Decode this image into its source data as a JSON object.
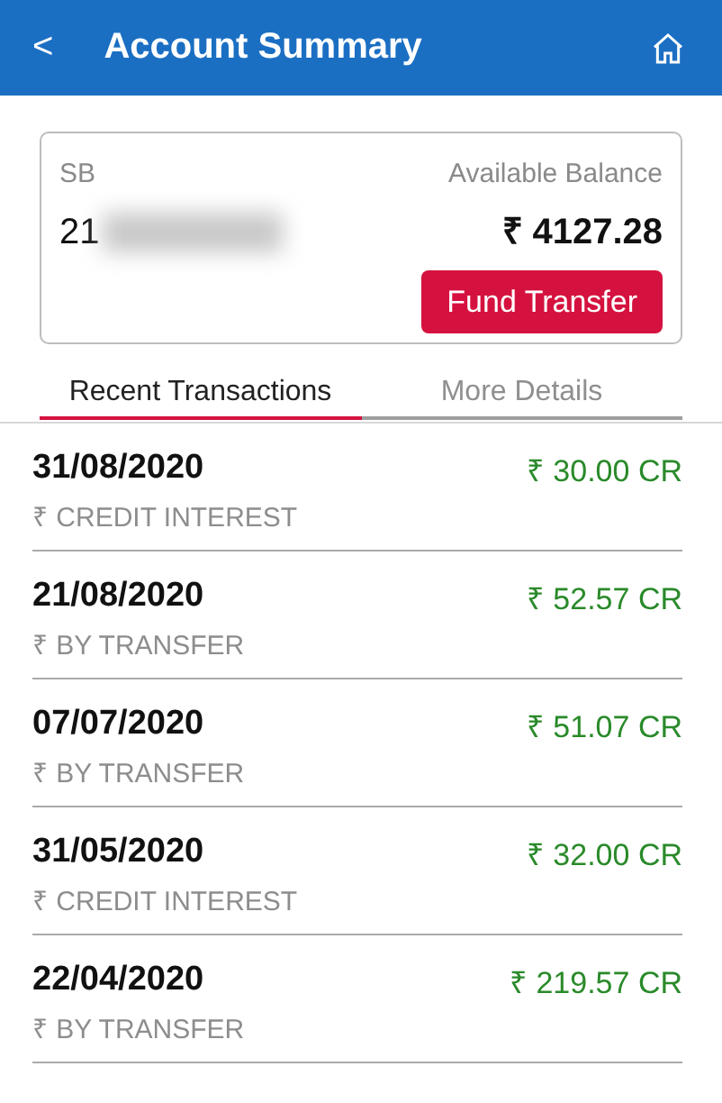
{
  "header": {
    "back": "<",
    "title": "Account Summary"
  },
  "account": {
    "type": "SB",
    "number": "21",
    "balance_label": "Available Balance",
    "balance": "₹ 4127.28",
    "fund_transfer": "Fund Transfer"
  },
  "tabs": [
    {
      "label": "Recent Transactions",
      "selected": true
    },
    {
      "label": "More Details",
      "selected": false
    }
  ],
  "transactions": [
    {
      "date": "31/08/2020",
      "description": "₹ CREDIT INTEREST",
      "amount": "₹ 30.00 CR"
    },
    {
      "date": "21/08/2020",
      "description": "₹ BY TRANSFER",
      "amount": "₹ 52.57 CR"
    },
    {
      "date": "07/07/2020",
      "description": "₹ BY TRANSFER",
      "amount": "₹ 51.07 CR"
    },
    {
      "date": "31/05/2020",
      "description": "₹ CREDIT INTEREST",
      "amount": "₹ 32.00 CR"
    },
    {
      "date": "22/04/2020",
      "description": "₹ BY TRANSFER",
      "amount": "₹ 219.57 CR"
    }
  ]
}
